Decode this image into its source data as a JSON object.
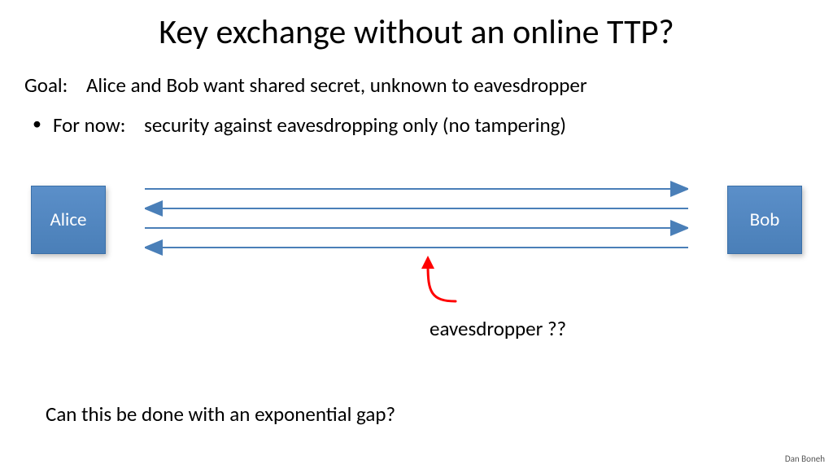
{
  "title": "Key exchange without an online TTP?",
  "goal_label": "Goal:",
  "goal_text": "Alice and Bob want shared secret, unknown to eavesdropper",
  "bullet_label": "For now:",
  "bullet_text": "security against eavesdropping only   (no tampering)",
  "alice": "Alice",
  "bob": "Bob",
  "eavesdropper": "eavesdropper ??",
  "question": "Can this be done with an exponential gap?",
  "author": "Dan Boneh",
  "colors": {
    "box": "#4a7fb8",
    "arrow": "#4a7fb8",
    "eaves_arrow": "#ff0000"
  },
  "arrows": [
    {
      "dir": "right"
    },
    {
      "dir": "left"
    },
    {
      "dir": "right"
    },
    {
      "dir": "left"
    }
  ]
}
